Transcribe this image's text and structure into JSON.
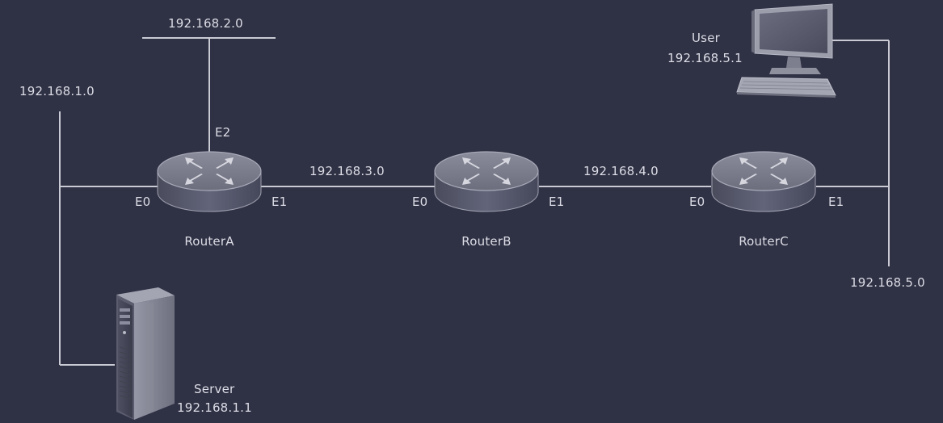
{
  "networks": {
    "net_1": "192.168.1.0",
    "net_2": "192.168.2.0",
    "net_3": "192.168.3.0",
    "net_4": "192.168.4.0",
    "net_5": "192.168.5.0"
  },
  "routers": {
    "a": {
      "name": "RouterA",
      "e0": "E0",
      "e1": "E1",
      "e2": "E2"
    },
    "b": {
      "name": "RouterB",
      "e0": "E0",
      "e1": "E1"
    },
    "c": {
      "name": "RouterC",
      "e0": "E0",
      "e1": "E1"
    }
  },
  "server": {
    "name": "Server",
    "ip": "192.168.1.1",
    "icon": "server-tower-icon"
  },
  "user": {
    "name": "User",
    "ip": "192.168.5.1",
    "icon": "desktop-computer-icon"
  },
  "colors": {
    "background": "#2f3144",
    "line": "#c9cad3",
    "text": "#dcdde6",
    "router_top": "#7c7e8d",
    "router_side": "#545666"
  }
}
